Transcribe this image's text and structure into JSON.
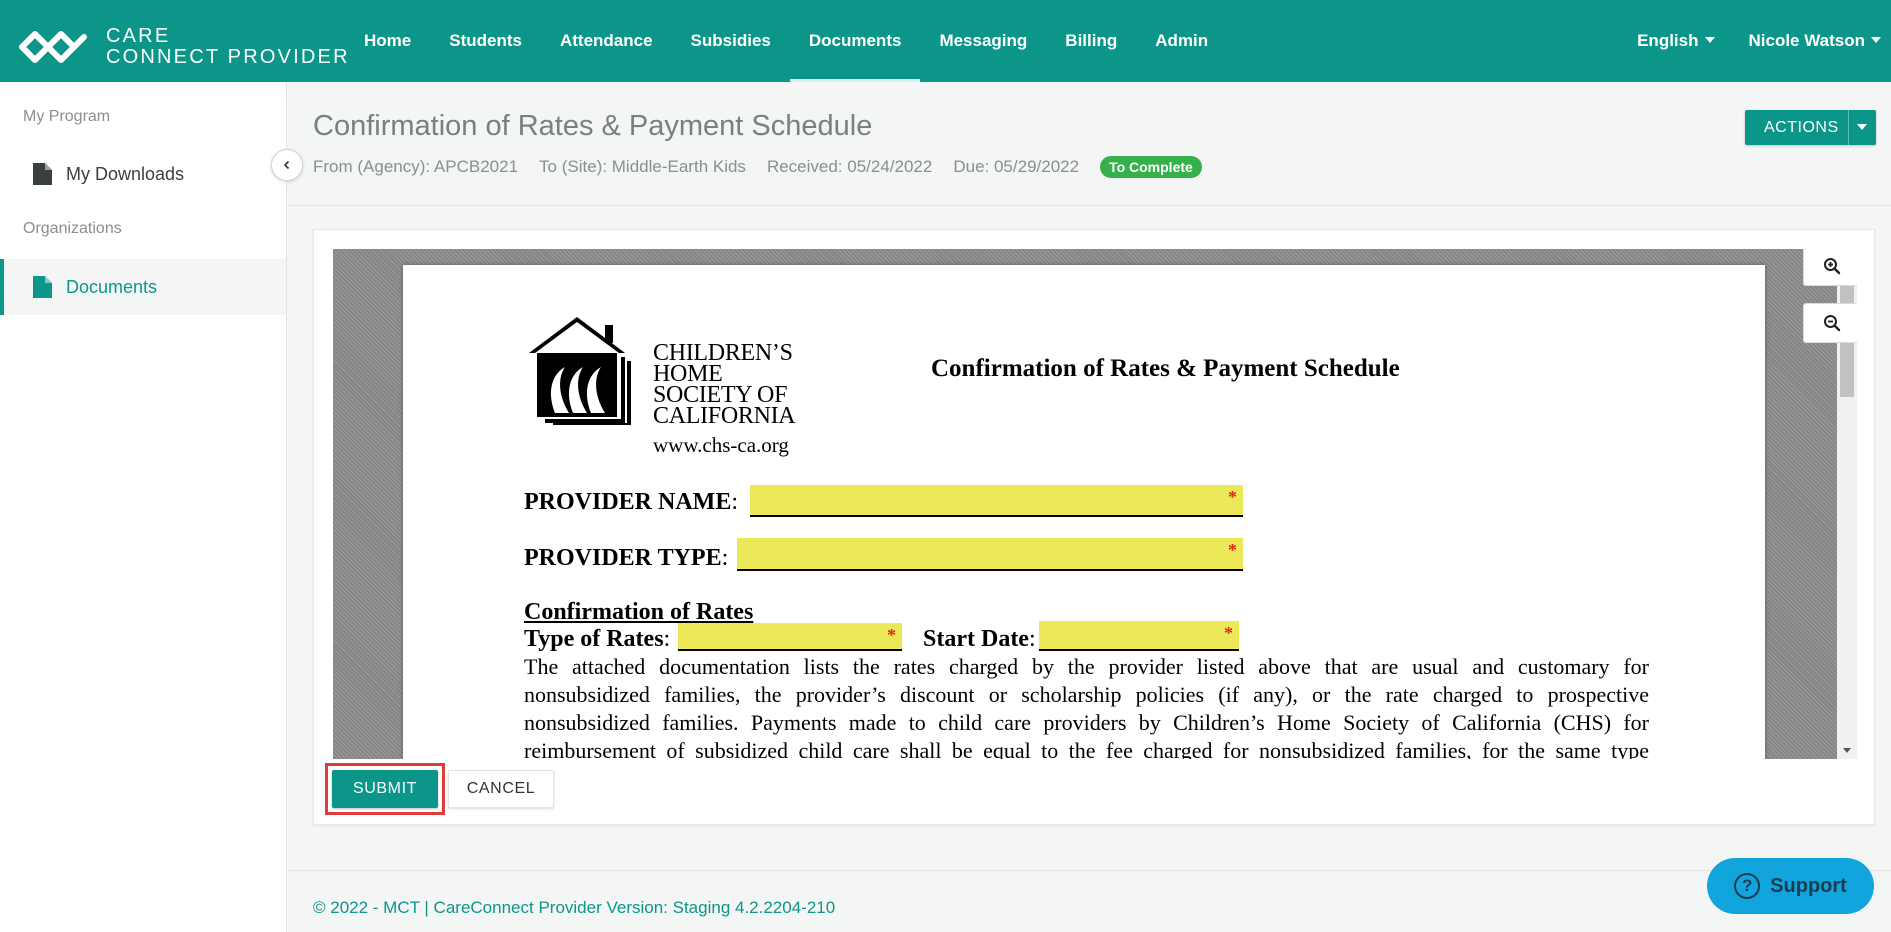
{
  "brand": {
    "line1": "CARE",
    "line2": "CONNECT PROVIDER"
  },
  "nav": {
    "items": [
      {
        "label": "Home"
      },
      {
        "label": "Students"
      },
      {
        "label": "Attendance"
      },
      {
        "label": "Subsidies"
      },
      {
        "label": "Documents",
        "active": true
      },
      {
        "label": "Messaging"
      },
      {
        "label": "Billing"
      },
      {
        "label": "Admin"
      }
    ],
    "language": "English",
    "user": "Nicole Watson"
  },
  "sidebar": {
    "section1": "My Program",
    "section2": "Organizations",
    "items": [
      {
        "label": "My Downloads"
      },
      {
        "label": "Documents",
        "active": true
      }
    ]
  },
  "document": {
    "title": "Confirmation of Rates & Payment Schedule",
    "from": "From (Agency): APCB2021",
    "to": "To (Site): Middle-Earth Kids",
    "received": "Received: 05/24/2022",
    "due": "Due: 05/29/2022",
    "status": "To Complete",
    "actions_label": "ACTIONS"
  },
  "pdf": {
    "org_name": [
      "CHILDREN’S",
      "HOME",
      "SOCIETY OF",
      "CALIFORNIA"
    ],
    "website": "www.chs-ca.org",
    "title": "Confirmation of Rates & Payment Schedule",
    "provider_name_label": "PROVIDER NAME",
    "provider_type_label": "PROVIDER TYPE",
    "section_heading": "Confirmation of Rates",
    "type_of_rates_label": "Type of Rates",
    "start_date_label": "Start Date",
    "colon": ":",
    "required_mark": "*",
    "paragraph_lines": [
      "The attached documentation lists the rates charged by the provider listed above that are usual and customary for",
      "nonsubsidized families, the provider’s discount or scholarship policies (if any), or the rate charged to prospective",
      "nonsubsidized families. Payments made to child care providers by Children’s Home Society of California (CHS) for",
      "reimbursement of subsidized child care shall be equal to the fee charged for nonsubsidized families, for the same type"
    ]
  },
  "buttons": {
    "submit": "SUBMIT",
    "cancel": "CANCEL",
    "support": "Support"
  },
  "footer": {
    "text": "© 2022 - MCT | CareConnect Provider Version: Staging 4.2.2204-210"
  },
  "colors": {
    "primary": "#0c968a",
    "status_green": "#35b04a",
    "field_yellow": "#ece85a",
    "highlight_red": "#e03c3c",
    "support_blue": "#12a4dd"
  }
}
